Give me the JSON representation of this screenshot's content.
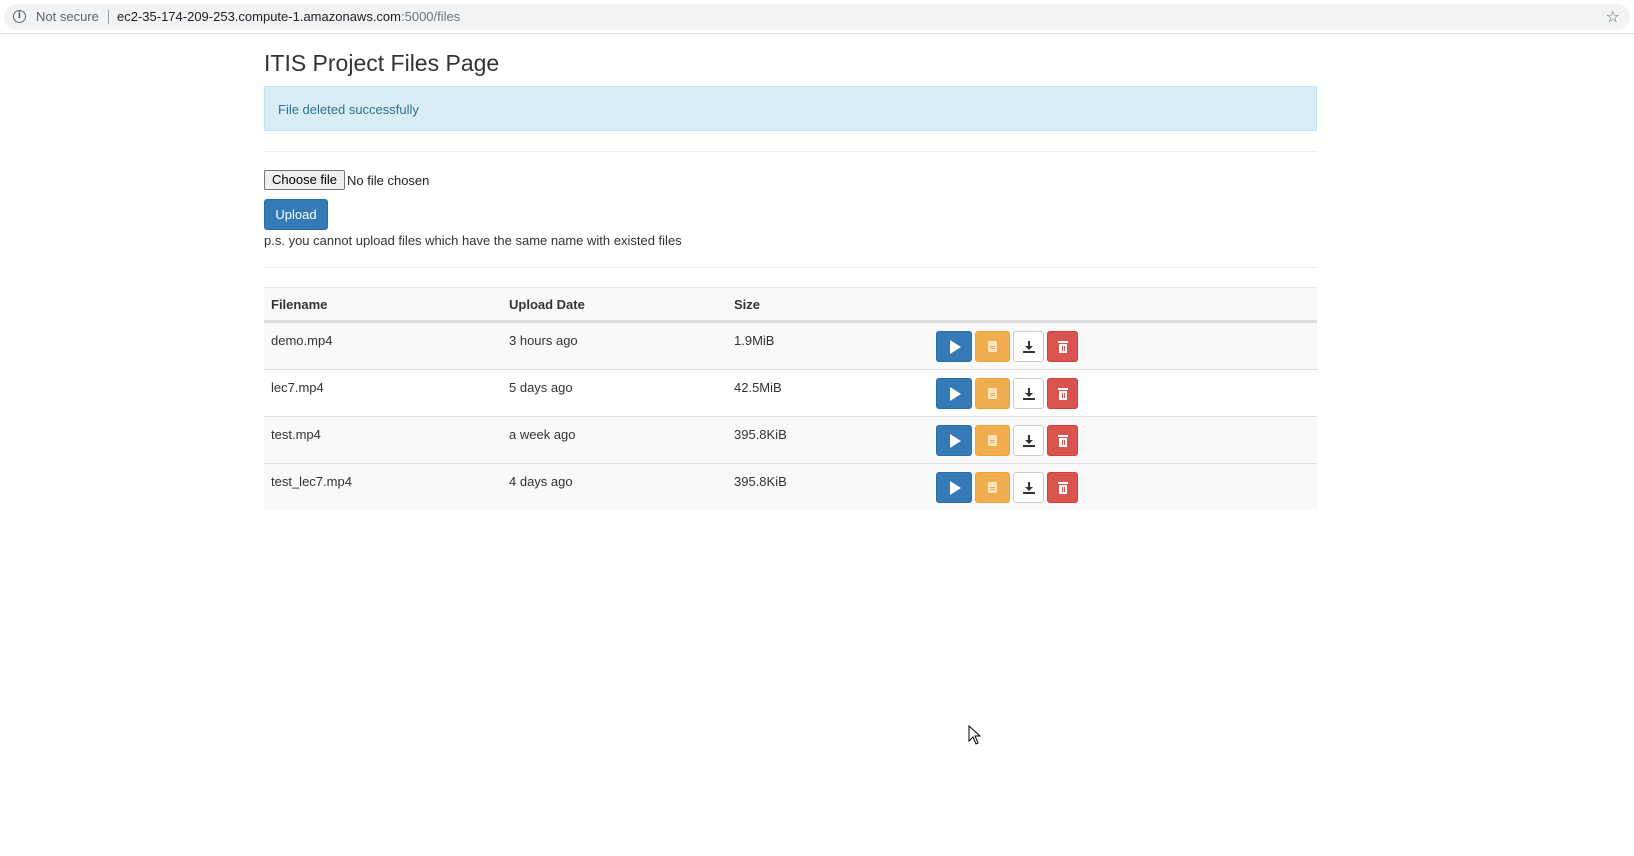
{
  "browser": {
    "security_label": "Not secure",
    "url_host": "ec2-35-174-209-253.compute-1.amazonaws.com",
    "url_path": ":5000/files"
  },
  "page": {
    "title": "ITIS Project Files Page",
    "alert_message": "File deleted successfully"
  },
  "upload": {
    "choose_file_label": "Choose file",
    "file_status": "No file chosen",
    "upload_label": "Upload",
    "note": "p.s. you cannot upload files which have the same name with existed files"
  },
  "table": {
    "headers": [
      "Filename",
      "Upload Date",
      "Size"
    ],
    "rows": [
      {
        "filename": "demo.mp4",
        "upload_date": "3 hours ago",
        "size": "1.9MiB"
      },
      {
        "filename": "lec7.mp4",
        "upload_date": "5 days ago",
        "size": "42.5MiB"
      },
      {
        "filename": "test.mp4",
        "upload_date": "a week ago",
        "size": "395.8KiB"
      },
      {
        "filename": "test_lec7.mp4",
        "upload_date": "4 days ago",
        "size": "395.8KiB"
      }
    ],
    "row_actions": [
      "play-icon",
      "file-icon",
      "download-icon",
      "trash-icon"
    ]
  },
  "colors": {
    "primary": "#337ab7",
    "warning": "#f0ad4e",
    "danger": "#d9534f",
    "info_bg": "#d9edf7"
  }
}
